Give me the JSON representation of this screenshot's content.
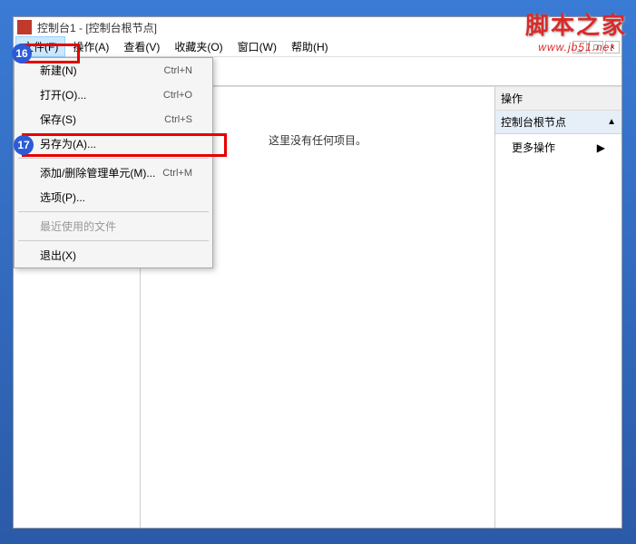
{
  "watermark": {
    "cn": "脚本之家",
    "en": "www.jb51.net"
  },
  "window": {
    "title": "控制台1 - [控制台根节点]"
  },
  "menubar": {
    "file": "文件(F)",
    "action": "操作(A)",
    "view": "查看(V)",
    "favorites": "收藏夹(O)",
    "window": "窗口(W)",
    "help": "帮助(H)"
  },
  "winControls": {
    "min": "_",
    "max": "□",
    "close": "×"
  },
  "dropdown": {
    "new": {
      "label": "新建(N)",
      "shortcut": "Ctrl+N"
    },
    "open": {
      "label": "打开(O)...",
      "shortcut": "Ctrl+O"
    },
    "save": {
      "label": "保存(S)",
      "shortcut": "Ctrl+S"
    },
    "saveas": {
      "label": "另存为(A)..."
    },
    "addremove": {
      "label": "添加/删除管理单元(M)...",
      "shortcut": "Ctrl+M"
    },
    "options": {
      "label": "选项(P)..."
    },
    "recent": {
      "label": "最近使用的文件"
    },
    "exit": {
      "label": "退出(X)"
    }
  },
  "main": {
    "empty": "这里没有任何项目。"
  },
  "actions": {
    "header": "操作",
    "section": "控制台根节点",
    "more": "更多操作"
  },
  "annotations": {
    "n16": "16",
    "n17": "17"
  }
}
